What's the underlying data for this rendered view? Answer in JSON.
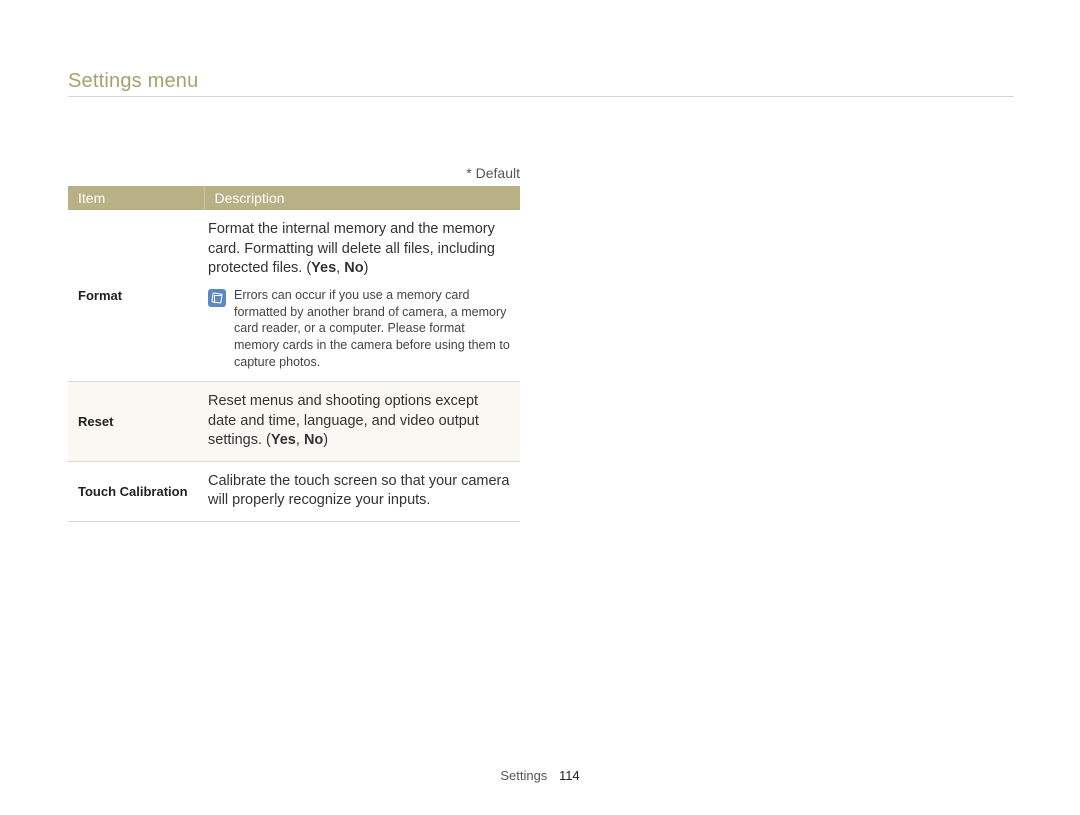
{
  "header": {
    "title": "Settings menu"
  },
  "default_note": "* Default",
  "table": {
    "headers": {
      "item": "Item",
      "description": "Description"
    },
    "rows": [
      {
        "item": "Format",
        "desc_main": "Format the internal memory and the memory card. Formatting will delete all files, including protected files. ",
        "options_open": "(",
        "option_yes": "Yes",
        "option_sep": ", ",
        "option_no": "No",
        "options_close": ")",
        "note": "Errors can occur if you use a memory card formatted by another brand of camera, a memory card reader, or a computer. Please format memory cards in the camera before using them to capture photos."
      },
      {
        "item": "Reset",
        "desc_main": "Reset menus and shooting options except date and time, language, and video output settings. ",
        "options_open": "(",
        "option_yes": "Yes",
        "option_sep": ", ",
        "option_no": "No",
        "options_close": ")"
      },
      {
        "item": "Touch Calibration",
        "desc_main": "Calibrate the touch screen so that your camera will properly recognize your inputs."
      }
    ]
  },
  "footer": {
    "section": "Settings",
    "page": "114"
  }
}
